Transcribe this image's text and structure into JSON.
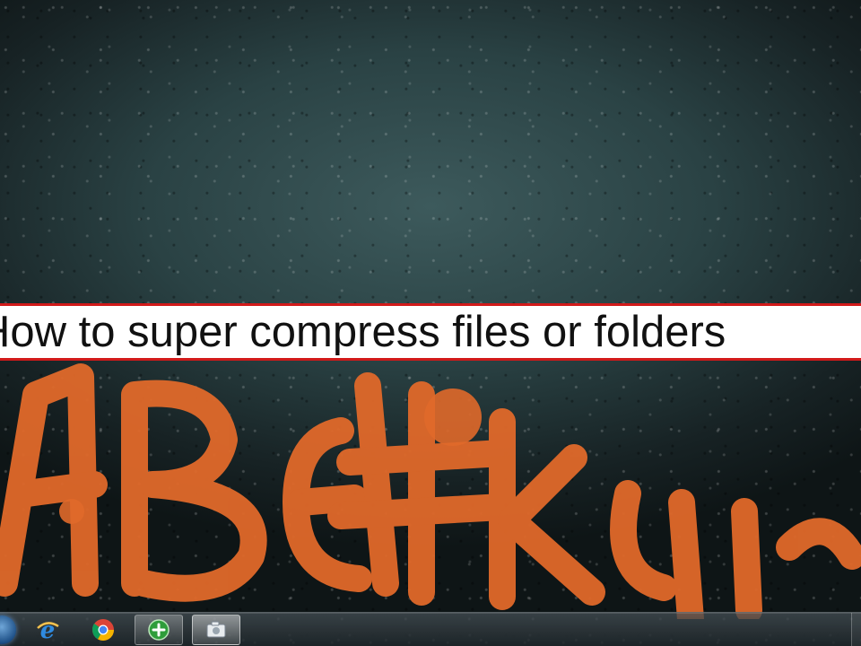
{
  "video_overlay": {
    "title": "How to super compress files or folders"
  },
  "desktop": {
    "wallpaper": "dark teal textured wall with orange graffiti",
    "colors": {
      "wall": "#2a4244",
      "graffiti": "#e0692a",
      "banner_border": "#d11a1a"
    }
  },
  "taskbar": {
    "start_icon": "windows-orb-icon",
    "items": [
      {
        "icon": "internet-explorer-icon",
        "state": "pinned"
      },
      {
        "icon": "chrome-icon",
        "state": "pinned"
      },
      {
        "icon": "green-plus-app-icon",
        "state": "running"
      },
      {
        "icon": "camera-app-icon",
        "state": "active"
      }
    ]
  }
}
